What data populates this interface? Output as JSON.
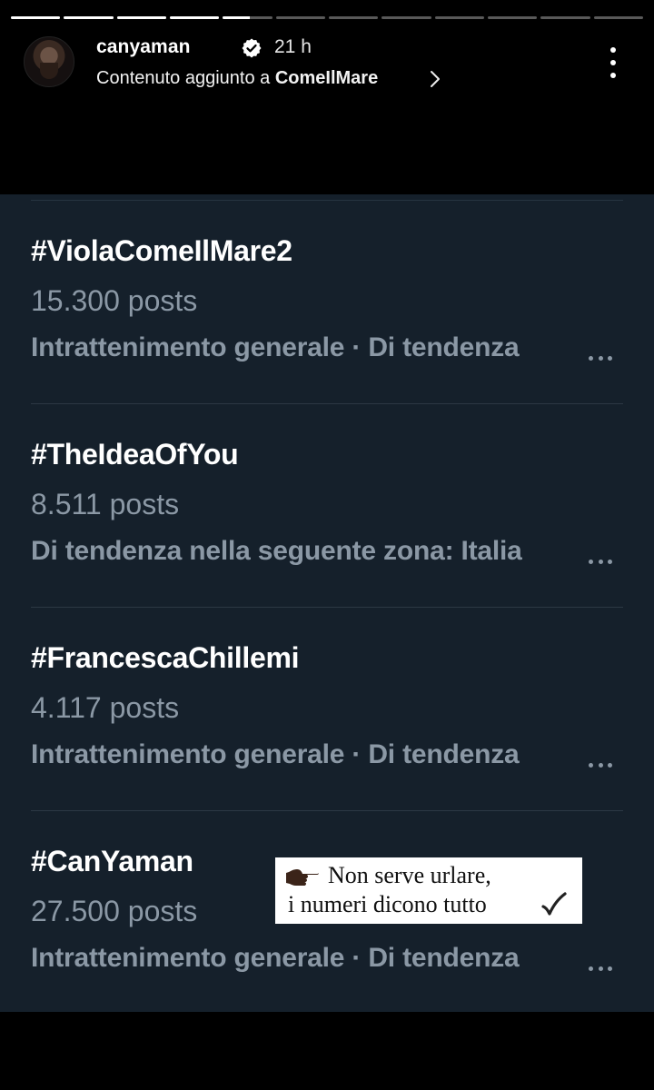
{
  "story": {
    "progress": [
      1,
      1,
      1,
      1,
      0.55,
      0,
      0,
      0,
      0,
      0,
      0,
      0
    ],
    "username": "canyaman",
    "time": "21 h",
    "subline_prefix": "Contenuto aggiunto a ",
    "subline_highlight": "ComeIlMare",
    "icons": {
      "verified": "verified-badge-icon",
      "chevron": "chevron-right-icon",
      "more": "more-vertical-icon"
    }
  },
  "trends": [
    {
      "tag": "#ViolaComeIlMare2",
      "count": "15.300 posts",
      "meta": "Intrattenimento generale · Di tendenza"
    },
    {
      "tag": "#TheIdeaOfYou",
      "count": "8.511 posts",
      "meta": "Di tendenza nella seguente zona: Italia"
    },
    {
      "tag": "#FrancescaChillemi",
      "count": "4.117 posts",
      "meta": "Intrattenimento generale · Di tendenza"
    },
    {
      "tag": "#CanYaman",
      "count": "27.500 posts",
      "meta": "Intrattenimento generale · Di tendenza"
    }
  ],
  "caption": {
    "line1": "Non serve urlare,",
    "line2": "i numeri dicono tutto",
    "icons": [
      "pointing-hand-icon",
      "check-mark-icon"
    ]
  },
  "colors": {
    "panel": "#15202b",
    "muted": "#8b98a5",
    "verified": "#ffffff"
  }
}
